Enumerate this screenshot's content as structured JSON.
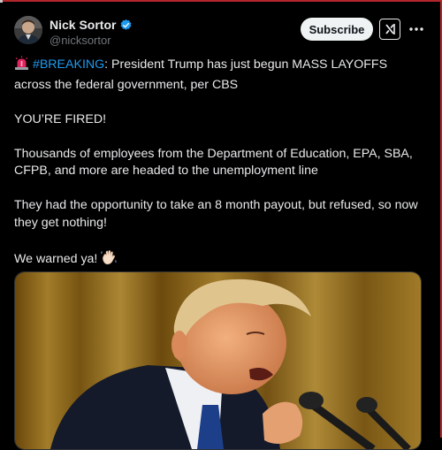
{
  "author": {
    "display_name": "Nick Sortor",
    "handle": "@nicksortor",
    "verified": true,
    "avatar_icon": "avatar-photo",
    "verified_icon": "verified-badge-icon",
    "verified_color": "#1d9bf0"
  },
  "actions": {
    "subscribe_label": "Subscribe",
    "grok_icon": "grok-icon",
    "more_icon": "more-options-icon"
  },
  "tweet": {
    "siren_icon": "siren-emoji",
    "hashtag": "#BREAKING",
    "line1_rest": ": President Trump has just begun MASS LAYOFFS across the federal government, per CBS",
    "line2": "YOU’RE FIRED!",
    "line3": "Thousands of employees from the Department of Education, EPA, SBA, CFPB, and more are headed to the unemployment line",
    "line4": "They had the opportunity to take an 8 month payout, but refused, so now they get nothing!",
    "line5": "We warned ya!",
    "wave_icon": "waving-hand-emoji"
  },
  "media": {
    "image_icon": "photo-speaker-at-microphone"
  },
  "colors": {
    "background": "#000000",
    "text": "#e7e9ea",
    "secondary_text": "#71767b",
    "link": "#1d9bf0",
    "frame": "#b3262b"
  }
}
